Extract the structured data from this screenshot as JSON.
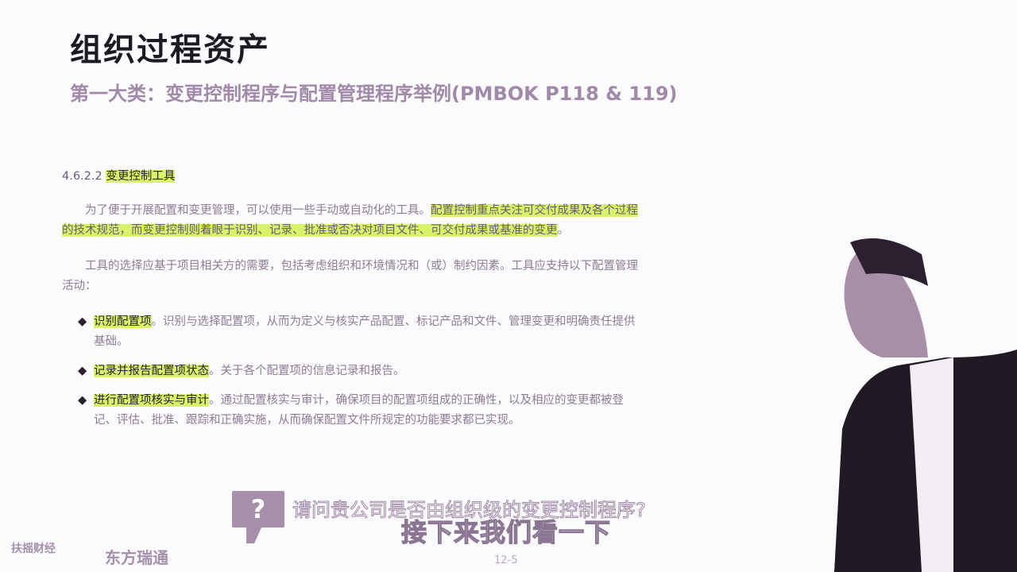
{
  "slide": {
    "title": "组织过程资产",
    "subtitle": "第一大类：变更控制程序与配置管理程序举例(PMBOK P118 & 119)",
    "page": "12-5"
  },
  "doc": {
    "section_no": "4.6.2.2",
    "section_title": "变更控制工具",
    "p1_plain": "为了便于开展配置和变更管理，可以使用一些手动或自动化的工具。",
    "p1_highlight": "配置控制重点关注可交付成果及各个过程的技术规范，而变更控制则着眼于识别、记录、批准或否决对项目文件、可交付成果或基准的变更",
    "p1_end": "。",
    "p2": "工具的选择应基于项目相关方的需要，包括考虑组织和环境情况和（或）制约因素。工具应支持以下配置管理活动：",
    "bullets": [
      {
        "term": "识别配置项",
        "text": "。识别与选择配置项，从而为定义与核实产品配置、标记产品和文件、管理变更和明确责任提供基础。"
      },
      {
        "term": "记录并报告配置项状态",
        "text": "。关于各个配置项的信息记录和报告。"
      },
      {
        "term": "进行配置项核实与审计",
        "text": "。通过配置核实与审计，确保项目的配置项组成的正确性，以及相应的变更都被登记、评估、批准、跟踪和正确实施，从而确保配置文件所规定的功能要求都已实现。"
      }
    ]
  },
  "overlay": {
    "question": "请问贵公司是否由组织级的变更控制程序?",
    "question_icon": "?",
    "caption": "接下来我们看一下"
  },
  "logos": {
    "logo1": "扶摇财经",
    "logo2": "东方瑞通"
  }
}
